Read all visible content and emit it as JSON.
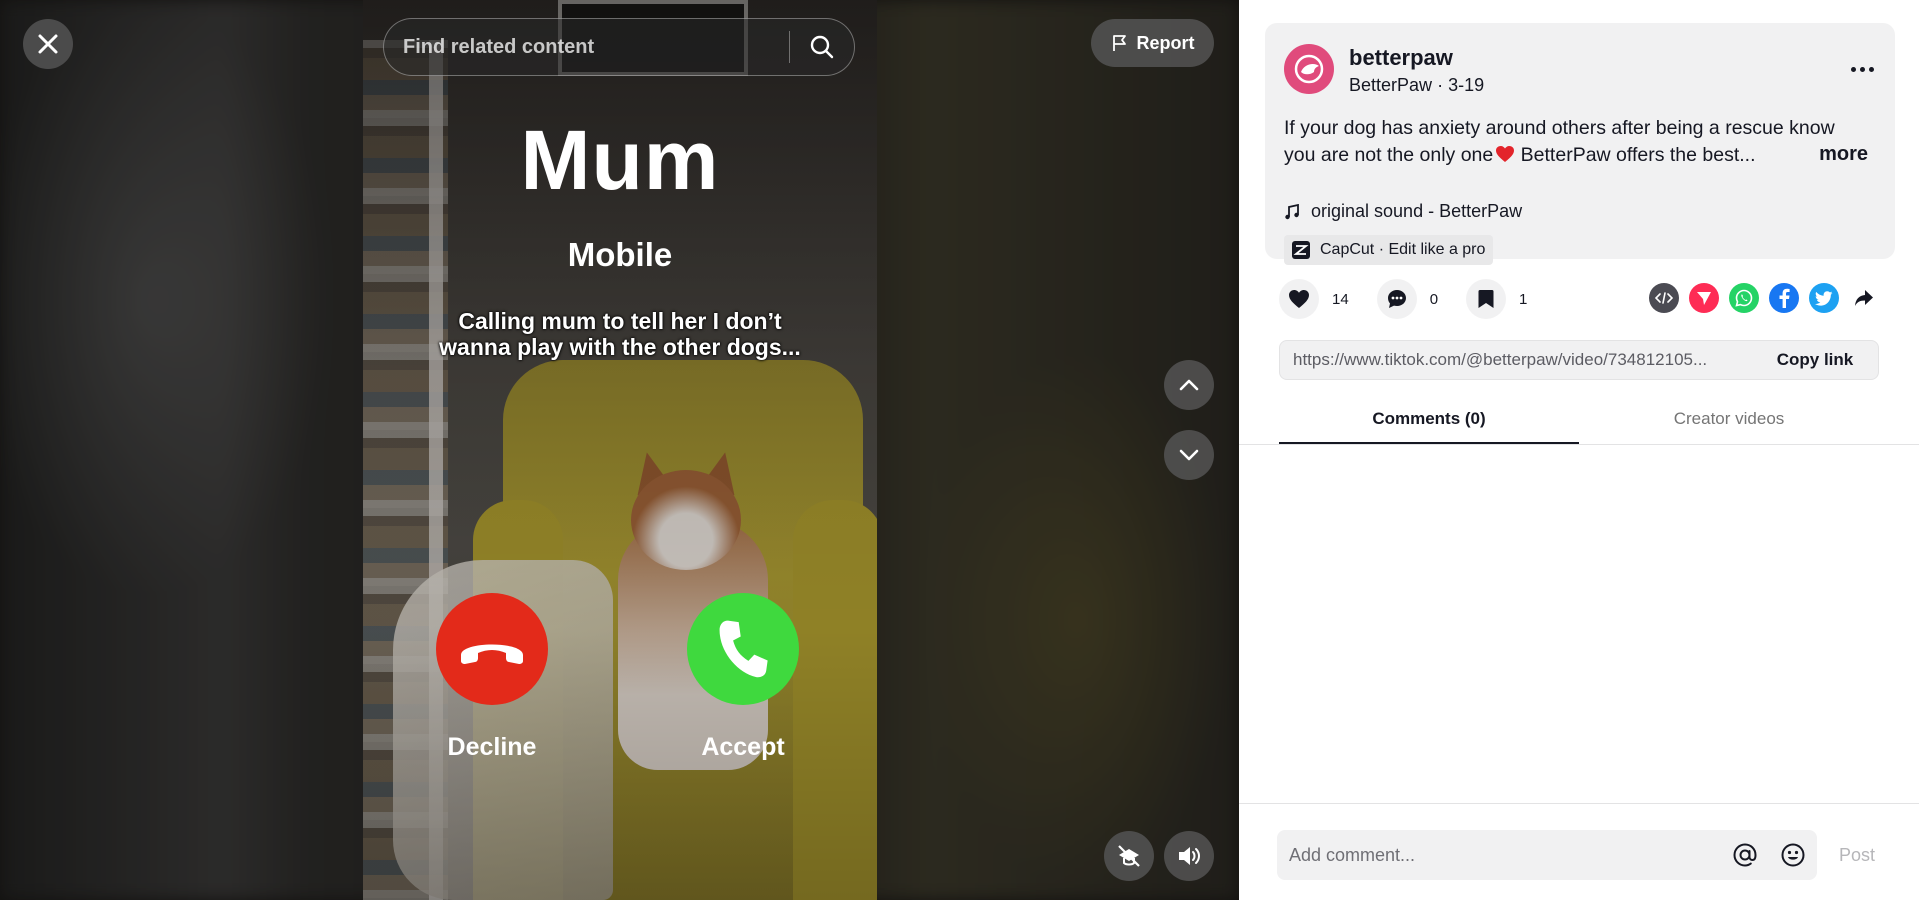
{
  "video": {
    "search_placeholder": "Find related content",
    "report_label": "Report",
    "call": {
      "name": "Mum",
      "subtitle": "Mobile",
      "caption_line1": "Calling mum to tell her I don’t",
      "caption_line2": "wanna play with the other dogs...",
      "decline_label": "Decline",
      "accept_label": "Accept"
    },
    "icons": {
      "close": "close-icon",
      "search": "search-icon",
      "report": "flag-icon",
      "nav_up": "chevron-up-icon",
      "nav_down": "chevron-down-icon",
      "pip": "floating-player-icon",
      "volume": "volume-icon"
    }
  },
  "post": {
    "username": "betterpaw",
    "display_name": "BetterPaw",
    "date": "3-19",
    "description_line1": "If your dog has anxiety around others after being a rescue know",
    "description_line2_a": "you are not the only one",
    "description_line2_b": " BetterPaw offers the best...",
    "more_label": "more",
    "sound": "original sound - BetterPaw",
    "capcut": "CapCut · Edit like a pro",
    "avatar_color": "#e04b7c"
  },
  "actions": {
    "likes": "14",
    "comments": "0",
    "saves": "1"
  },
  "share": {
    "icons": [
      "embed-icon",
      "send-icon",
      "whatsapp-icon",
      "facebook-icon",
      "twitter-icon",
      "share-arrow-icon"
    ],
    "colors": {
      "embed": "#4b4b53",
      "send": "#fe2c55",
      "whatsapp": "#25d366",
      "facebook": "#1877f2",
      "twitter": "#1da1f2"
    }
  },
  "link": {
    "url": "https://www.tiktok.com/@betterpaw/video/734812105...",
    "copy_label": "Copy link"
  },
  "tabs": {
    "comments": "Comments (0)",
    "creator_videos": "Creator videos"
  },
  "comment_bar": {
    "placeholder": "Add comment...",
    "post_label": "Post"
  },
  "colors": {
    "decline": "#e32a1a",
    "accept": "#3fd93e"
  }
}
